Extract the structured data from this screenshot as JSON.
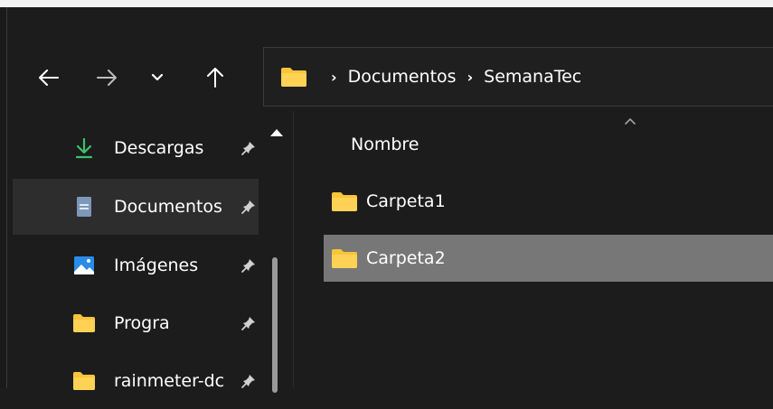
{
  "nav": {
    "back_icon": "arrow-left-icon",
    "forward_icon": "arrow-right-icon",
    "recent_icon": "chevron-down-icon",
    "up_icon": "arrow-up-icon"
  },
  "address": {
    "crumbs": [
      "Documentos",
      "SemanaTec"
    ],
    "folder_color": "#f8c43a"
  },
  "sidebar": {
    "items": [
      {
        "label": "Descargas",
        "icon": "download-icon",
        "pinned": true,
        "selected": false
      },
      {
        "label": "Documentos",
        "icon": "document-icon",
        "pinned": true,
        "selected": true
      },
      {
        "label": "Imágenes",
        "icon": "image-icon",
        "pinned": true,
        "selected": false
      },
      {
        "label": "Progra",
        "icon": "folder-icon",
        "pinned": true,
        "selected": false
      },
      {
        "label": "rainmeter-dc",
        "icon": "folder-icon",
        "pinned": true,
        "selected": false
      }
    ]
  },
  "content": {
    "column_header": "Nombre",
    "rows": [
      {
        "name": "Carpeta1",
        "selected": false
      },
      {
        "name": "Carpeta2",
        "selected": true
      }
    ]
  },
  "colors": {
    "background": "#1c1c1c",
    "selected_row": "#777777",
    "selected_nav": "#2d2d2d",
    "folder": "#f8c43a",
    "download_green": "#3fc06b"
  }
}
